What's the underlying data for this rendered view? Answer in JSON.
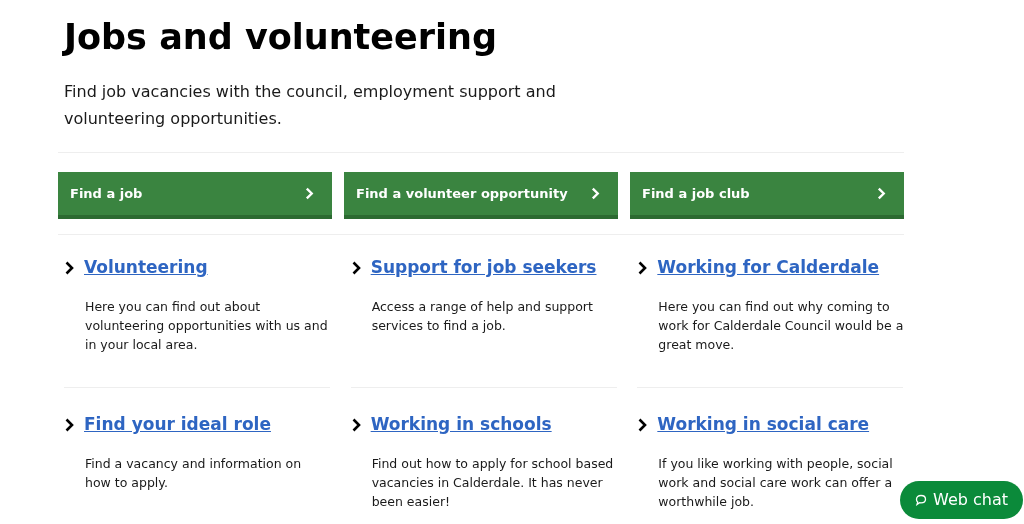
{
  "page": {
    "title": "Jobs and volunteering",
    "intro": "Find job vacancies with the council, employment support and volunteering opportunities."
  },
  "buttons": [
    {
      "label": "Find a job"
    },
    {
      "label": "Find a volunteer opportunity"
    },
    {
      "label": "Find a job club"
    }
  ],
  "cards": [
    {
      "title": "Volunteering",
      "description": "Here you can find out about volunteering opportunities with us and in your local area."
    },
    {
      "title": "Support for job seekers",
      "description": "Access a range of help and support services to find a job."
    },
    {
      "title": "Working for Calderdale",
      "description": "Here you can find out why coming to work for Calderdale Council would be a great move."
    },
    {
      "title": "Find your ideal role",
      "description": "Find a vacancy and information on how to apply."
    },
    {
      "title": "Working in schools",
      "description": "Find out how to apply for school based vacancies in Calderdale. It has never been easier!"
    },
    {
      "title": "Working in social care",
      "description": "If you like working with people, social work and social care work can offer a worthwhile job."
    }
  ],
  "web_chat": {
    "label": "Web chat"
  }
}
